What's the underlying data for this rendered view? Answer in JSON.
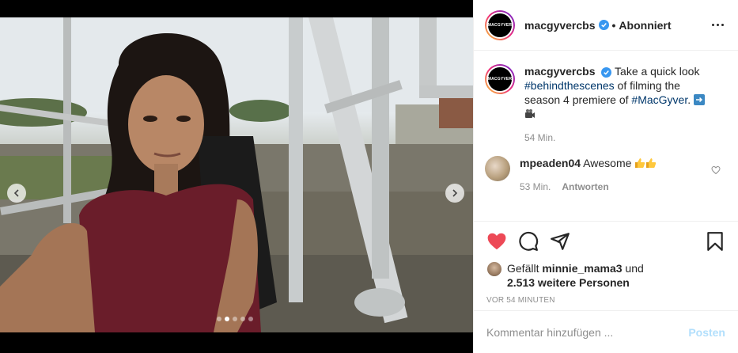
{
  "post": {
    "username": "macgyvercbs",
    "avatar_text": "MACGYVER",
    "follow_label": "Abonniert",
    "separator": "•",
    "more_icon": "more-horizontal-icon"
  },
  "caption": {
    "username": "macgyvercbs",
    "text_1": "Take a quick look",
    "hashtag_1": "#behindthescenes",
    "text_2": "of filming the season 4 premiere of",
    "hashtag_2": "#MacGyver",
    "text_3": ".",
    "time": "54 Min."
  },
  "comment": {
    "username": "mpeaden04",
    "text": "Awesome",
    "time": "53 Min.",
    "reply_label": "Antworten"
  },
  "likes": {
    "prefix": "Gefällt",
    "user": "minnie_mama3",
    "conjunction": "und",
    "count": "2.513 weitere Personen"
  },
  "timeago": "VOR 54 MINUTEN",
  "add_comment": {
    "placeholder": "Kommentar hinzufügen ...",
    "post_label": "Posten"
  },
  "carousel": {
    "dots": 5,
    "active_index": 2
  },
  "colors": {
    "like_red": "#ed4956",
    "link_blue": "#00376b",
    "verified_blue": "#3897f0",
    "post_disabled": "#b2dffc"
  }
}
